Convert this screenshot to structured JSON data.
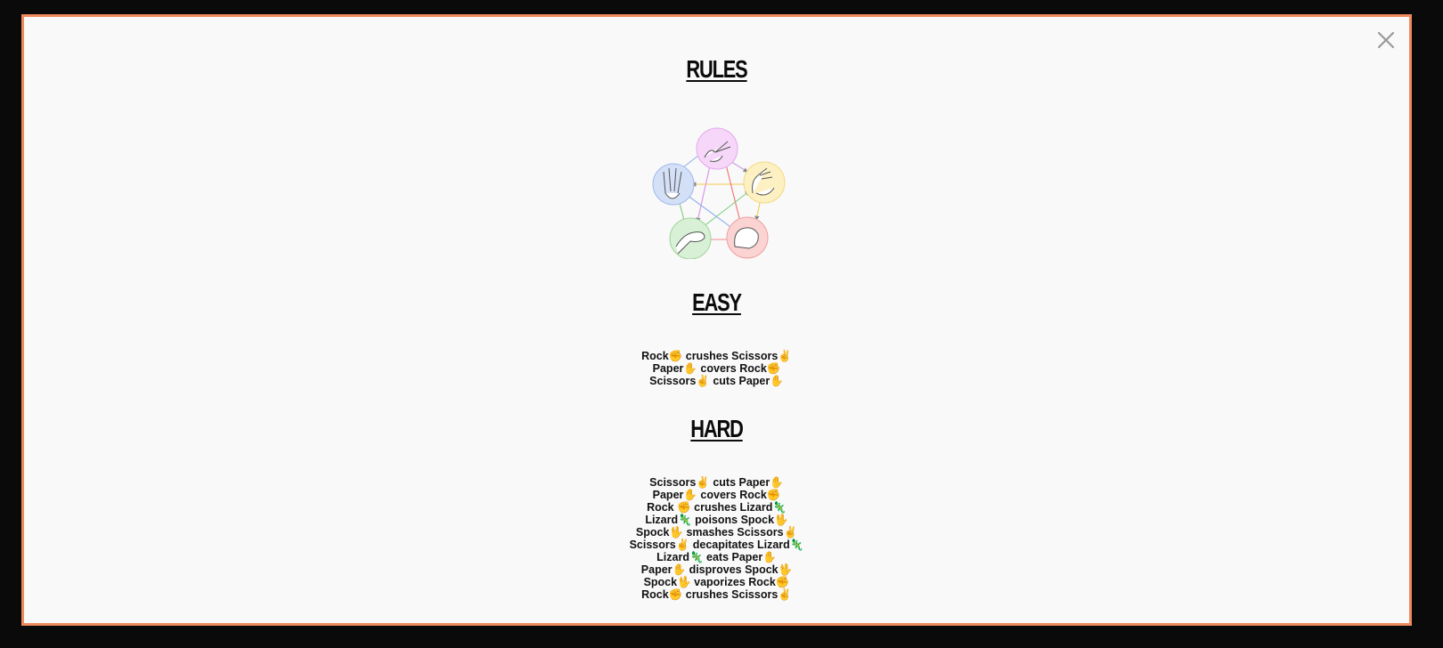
{
  "modal": {
    "close_icon": "close-icon",
    "accent_color": "#f08a5d"
  },
  "rules": {
    "title": "RULES",
    "diagram_icons": [
      "scissors-hand-icon",
      "paper-hand-icon",
      "rock-hand-icon",
      "lizard-hand-icon",
      "spock-hand-icon"
    ],
    "diagram_colors": {
      "scissors": "#f3c8f7",
      "paper": "#fdeeb4",
      "rock": "#f9c6c6",
      "lizard": "#cdeccb",
      "spock": "#c9d9f5"
    }
  },
  "easy": {
    "title": "EASY",
    "items": [
      "Rock✊ crushes Scissors✌",
      "Paper✋ covers Rock✊",
      "Scissors✌ cuts Paper✋"
    ]
  },
  "hard": {
    "title": "HARD",
    "items": [
      "Scissors✌ cuts Paper✋",
      "Paper✋ covers Rock✊",
      "Rock ✊ crushes Lizard🦎",
      "Lizard🦎 poisons Spock🖖",
      "Spock🖖 smashes Scissors✌",
      "Scissors✌ decapitates Lizard🦎",
      "Lizard🦎 eats Paper✋",
      "Paper✋ disproves Spock🖖",
      "Spock🖖 vaporizes Rock✊",
      "Rock✊ crushes Scissors✌"
    ]
  }
}
